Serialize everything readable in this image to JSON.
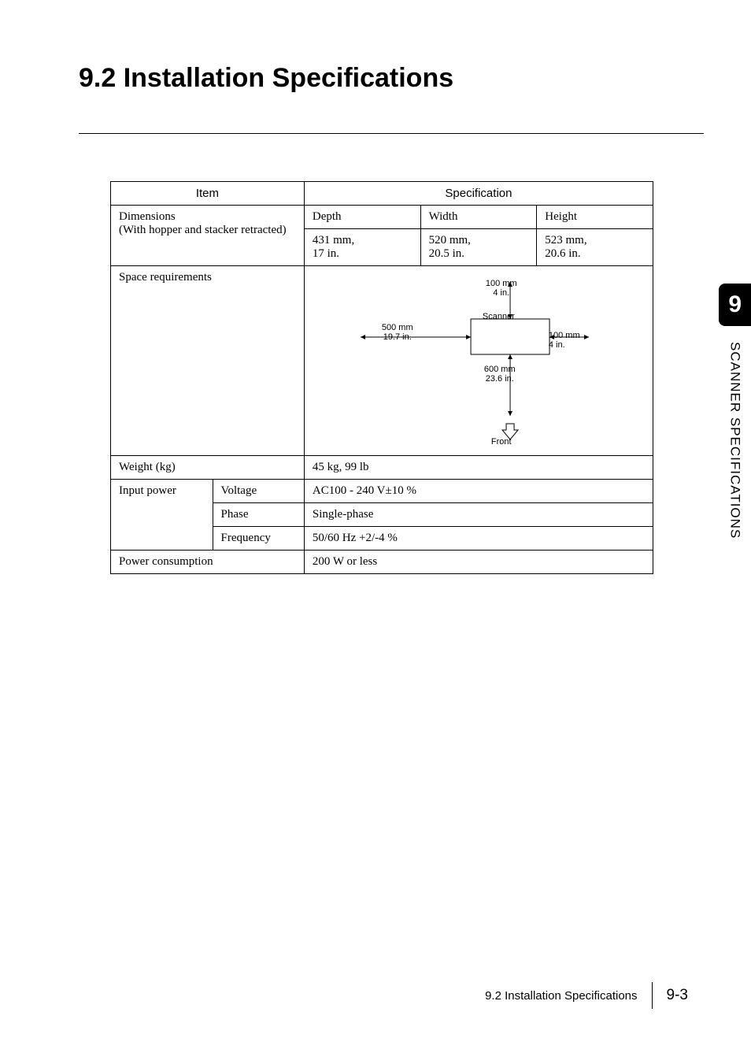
{
  "title": "9.2  Installation Specifications",
  "table": {
    "headers": {
      "item": "Item",
      "spec": "Specification"
    },
    "dimensions": {
      "label": "Dimensions",
      "sublabel": "(With hopper and stacker retracted)",
      "depth_h": "Depth",
      "width_h": "Width",
      "height_h": "Height",
      "depth": "431 mm,\n17 in.",
      "width": "520 mm,\n20.5 in.",
      "height": "523 mm,\n20.6 in."
    },
    "space": {
      "label": "Space requirements",
      "diagram": {
        "top": "100 mm\n4 in.",
        "left": "500 mm\n19.7 in.",
        "right": "100 mm\n4 in.",
        "bottom": "600 mm\n23.6 in.",
        "scanner": "Scanner",
        "front": "Front"
      }
    },
    "weight": {
      "label": "Weight (kg)",
      "value": "45 kg, 99 lb"
    },
    "input_power": {
      "label": "Input power",
      "voltage_l": "Voltage",
      "voltage_v": "AC100 - 240 V±10 %",
      "phase_l": "Phase",
      "phase_v": "Single-phase",
      "freq_l": "Frequency",
      "freq_v": "50/60 Hz +2/-4 %"
    },
    "power_cons": {
      "label": "Power consumption",
      "value": "200 W or less"
    }
  },
  "sidebar": {
    "chapter": "9",
    "title": "SCANNER SPECIFICATIONS"
  },
  "footer": {
    "section": "9.2 Installation Specifications",
    "page": "9-3"
  }
}
